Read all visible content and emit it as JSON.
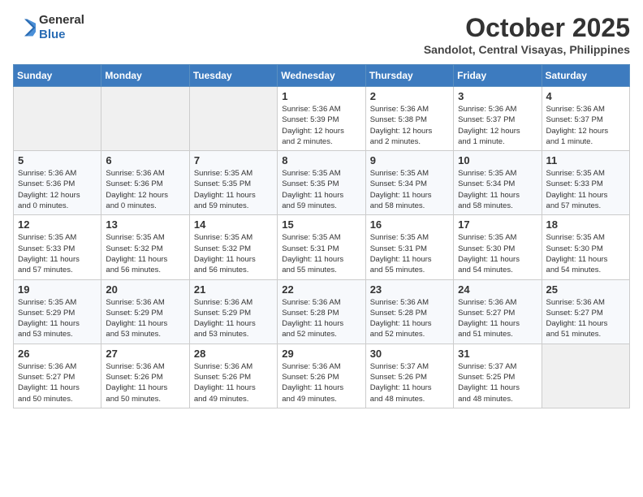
{
  "logo": {
    "line1": "General",
    "line2": "Blue"
  },
  "title": "October 2025",
  "subtitle": "Sandolot, Central Visayas, Philippines",
  "days_of_week": [
    "Sunday",
    "Monday",
    "Tuesday",
    "Wednesday",
    "Thursday",
    "Friday",
    "Saturday"
  ],
  "weeks": [
    [
      {
        "day": "",
        "info": ""
      },
      {
        "day": "",
        "info": ""
      },
      {
        "day": "",
        "info": ""
      },
      {
        "day": "1",
        "info": "Sunrise: 5:36 AM\nSunset: 5:39 PM\nDaylight: 12 hours\nand 2 minutes."
      },
      {
        "day": "2",
        "info": "Sunrise: 5:36 AM\nSunset: 5:38 PM\nDaylight: 12 hours\nand 2 minutes."
      },
      {
        "day": "3",
        "info": "Sunrise: 5:36 AM\nSunset: 5:37 PM\nDaylight: 12 hours\nand 1 minute."
      },
      {
        "day": "4",
        "info": "Sunrise: 5:36 AM\nSunset: 5:37 PM\nDaylight: 12 hours\nand 1 minute."
      }
    ],
    [
      {
        "day": "5",
        "info": "Sunrise: 5:36 AM\nSunset: 5:36 PM\nDaylight: 12 hours\nand 0 minutes."
      },
      {
        "day": "6",
        "info": "Sunrise: 5:36 AM\nSunset: 5:36 PM\nDaylight: 12 hours\nand 0 minutes."
      },
      {
        "day": "7",
        "info": "Sunrise: 5:35 AM\nSunset: 5:35 PM\nDaylight: 11 hours\nand 59 minutes."
      },
      {
        "day": "8",
        "info": "Sunrise: 5:35 AM\nSunset: 5:35 PM\nDaylight: 11 hours\nand 59 minutes."
      },
      {
        "day": "9",
        "info": "Sunrise: 5:35 AM\nSunset: 5:34 PM\nDaylight: 11 hours\nand 58 minutes."
      },
      {
        "day": "10",
        "info": "Sunrise: 5:35 AM\nSunset: 5:34 PM\nDaylight: 11 hours\nand 58 minutes."
      },
      {
        "day": "11",
        "info": "Sunrise: 5:35 AM\nSunset: 5:33 PM\nDaylight: 11 hours\nand 57 minutes."
      }
    ],
    [
      {
        "day": "12",
        "info": "Sunrise: 5:35 AM\nSunset: 5:33 PM\nDaylight: 11 hours\nand 57 minutes."
      },
      {
        "day": "13",
        "info": "Sunrise: 5:35 AM\nSunset: 5:32 PM\nDaylight: 11 hours\nand 56 minutes."
      },
      {
        "day": "14",
        "info": "Sunrise: 5:35 AM\nSunset: 5:32 PM\nDaylight: 11 hours\nand 56 minutes."
      },
      {
        "day": "15",
        "info": "Sunrise: 5:35 AM\nSunset: 5:31 PM\nDaylight: 11 hours\nand 55 minutes."
      },
      {
        "day": "16",
        "info": "Sunrise: 5:35 AM\nSunset: 5:31 PM\nDaylight: 11 hours\nand 55 minutes."
      },
      {
        "day": "17",
        "info": "Sunrise: 5:35 AM\nSunset: 5:30 PM\nDaylight: 11 hours\nand 54 minutes."
      },
      {
        "day": "18",
        "info": "Sunrise: 5:35 AM\nSunset: 5:30 PM\nDaylight: 11 hours\nand 54 minutes."
      }
    ],
    [
      {
        "day": "19",
        "info": "Sunrise: 5:35 AM\nSunset: 5:29 PM\nDaylight: 11 hours\nand 53 minutes."
      },
      {
        "day": "20",
        "info": "Sunrise: 5:36 AM\nSunset: 5:29 PM\nDaylight: 11 hours\nand 53 minutes."
      },
      {
        "day": "21",
        "info": "Sunrise: 5:36 AM\nSunset: 5:29 PM\nDaylight: 11 hours\nand 53 minutes."
      },
      {
        "day": "22",
        "info": "Sunrise: 5:36 AM\nSunset: 5:28 PM\nDaylight: 11 hours\nand 52 minutes."
      },
      {
        "day": "23",
        "info": "Sunrise: 5:36 AM\nSunset: 5:28 PM\nDaylight: 11 hours\nand 52 minutes."
      },
      {
        "day": "24",
        "info": "Sunrise: 5:36 AM\nSunset: 5:27 PM\nDaylight: 11 hours\nand 51 minutes."
      },
      {
        "day": "25",
        "info": "Sunrise: 5:36 AM\nSunset: 5:27 PM\nDaylight: 11 hours\nand 51 minutes."
      }
    ],
    [
      {
        "day": "26",
        "info": "Sunrise: 5:36 AM\nSunset: 5:27 PM\nDaylight: 11 hours\nand 50 minutes."
      },
      {
        "day": "27",
        "info": "Sunrise: 5:36 AM\nSunset: 5:26 PM\nDaylight: 11 hours\nand 50 minutes."
      },
      {
        "day": "28",
        "info": "Sunrise: 5:36 AM\nSunset: 5:26 PM\nDaylight: 11 hours\nand 49 minutes."
      },
      {
        "day": "29",
        "info": "Sunrise: 5:36 AM\nSunset: 5:26 PM\nDaylight: 11 hours\nand 49 minutes."
      },
      {
        "day": "30",
        "info": "Sunrise: 5:37 AM\nSunset: 5:26 PM\nDaylight: 11 hours\nand 48 minutes."
      },
      {
        "day": "31",
        "info": "Sunrise: 5:37 AM\nSunset: 5:25 PM\nDaylight: 11 hours\nand 48 minutes."
      },
      {
        "day": "",
        "info": ""
      }
    ]
  ]
}
